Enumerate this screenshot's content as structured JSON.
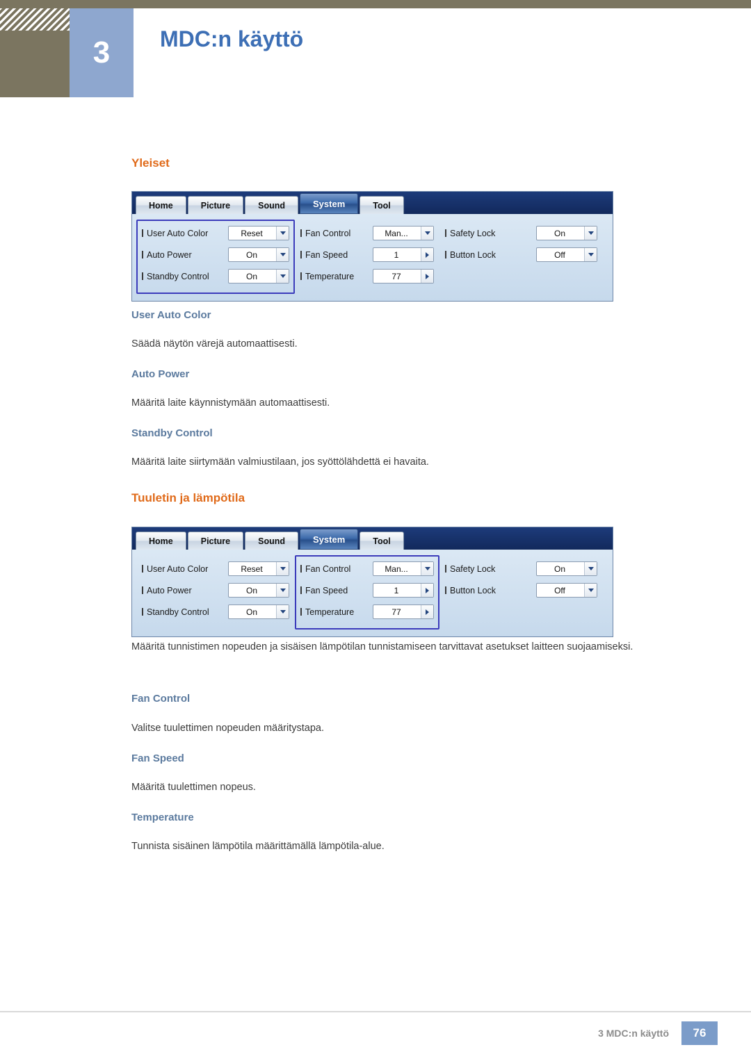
{
  "header": {
    "chapter_number": "3",
    "chapter_title": "MDC:n käyttö"
  },
  "sections": [
    {
      "heading": "Yleiset",
      "items": [
        {
          "title": "User Auto Color",
          "text": "Säädä näytön värejä automaattisesti."
        },
        {
          "title": "Auto Power",
          "text": "Määritä laite käynnistymään automaattisesti."
        },
        {
          "title": "Standby Control",
          "text": "Määritä laite siirtymään valmiustilaan, jos syöttölähdettä ei havaita."
        }
      ]
    },
    {
      "heading": "Tuuletin ja lämpötila",
      "intro": "Määritä tunnistimen nopeuden ja sisäisen lämpötilan tunnistamiseen tarvittavat asetukset laitteen suojaamiseksi.",
      "items": [
        {
          "title": "Fan Control",
          "text": "Valitse tuulettimen nopeuden määritystapa."
        },
        {
          "title": "Fan Speed",
          "text": "Määritä tuulettimen nopeus."
        },
        {
          "title": "Temperature",
          "text": "Tunnista sisäinen lämpötila määrittämällä lämpötila-alue."
        }
      ]
    }
  ],
  "mdc": {
    "tabs": [
      "Home",
      "Picture",
      "Sound",
      "System",
      "Tool"
    ],
    "selected_tab": "System",
    "columns": [
      {
        "rows": [
          {
            "label": "User Auto Color",
            "value": "Reset",
            "control": "dropdown"
          },
          {
            "label": "Auto Power",
            "value": "On",
            "control": "dropdown"
          },
          {
            "label": "Standby Control",
            "value": "On",
            "control": "dropdown"
          }
        ]
      },
      {
        "rows": [
          {
            "label": "Fan Control",
            "value": "Man...",
            "control": "dropdown"
          },
          {
            "label": "Fan Speed",
            "value": "1",
            "control": "spinner"
          },
          {
            "label": "Temperature",
            "value": "77",
            "control": "spinner"
          }
        ]
      },
      {
        "rows": [
          {
            "label": "Safety Lock",
            "value": "On",
            "control": "dropdown"
          },
          {
            "label": "Button Lock",
            "value": "Off",
            "control": "dropdown"
          }
        ]
      }
    ],
    "highlight_first": 0,
    "highlight_second": 1
  },
  "footer": {
    "text": "3 MDC:n käyttö",
    "page": "76"
  }
}
